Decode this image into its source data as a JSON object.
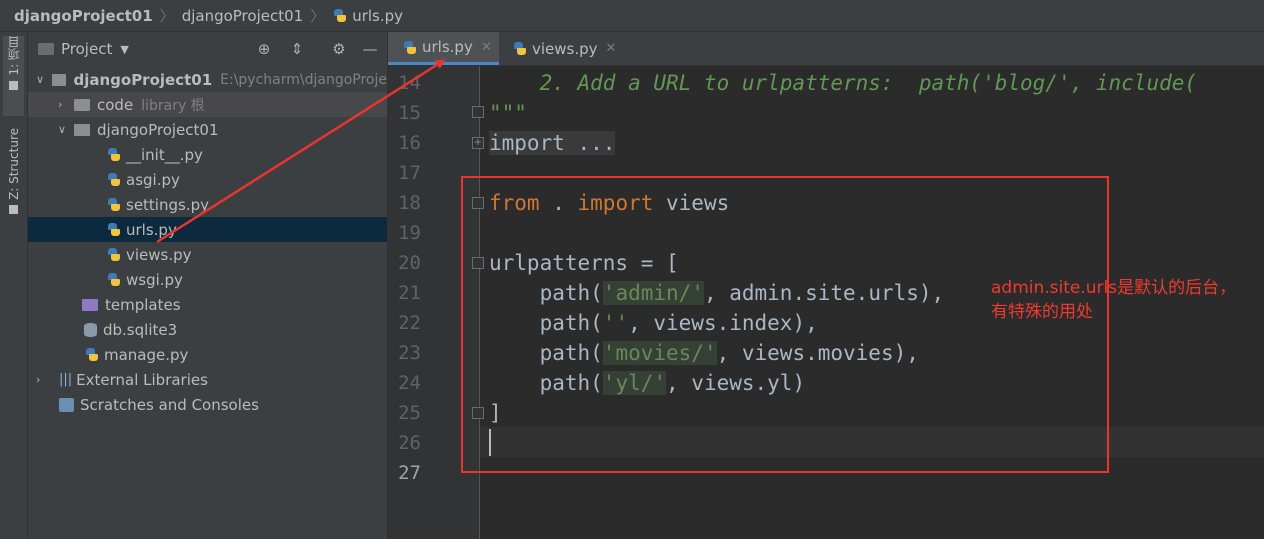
{
  "breadcrumb": [
    "djangoProject01",
    "djangoProject01",
    "urls.py"
  ],
  "left_strip": {
    "project_tab": "1: 项目",
    "structure_tab": "Z: Structure"
  },
  "project_panel": {
    "title": "Project",
    "tree": [
      {
        "label": "djangoProject01",
        "hint": "E:\\pycharm\\djangoProje",
        "expanded": true,
        "icon": "folder-icon"
      },
      {
        "label": "code",
        "hint": "library 根",
        "expanded": false,
        "icon": "folder-icon"
      },
      {
        "label": "djangoProject01",
        "hint": "",
        "expanded": true,
        "icon": "folder-icon"
      },
      {
        "label": "__init__.py",
        "icon": "python-file-icon"
      },
      {
        "label": "asgi.py",
        "icon": "python-file-icon"
      },
      {
        "label": "settings.py",
        "icon": "python-file-icon"
      },
      {
        "label": "urls.py",
        "icon": "python-file-icon",
        "selected": true
      },
      {
        "label": "views.py",
        "icon": "python-file-icon"
      },
      {
        "label": "wsgi.py",
        "icon": "python-file-icon"
      },
      {
        "label": "templates",
        "icon": "folder-icon"
      },
      {
        "label": "db.sqlite3",
        "icon": "database-icon"
      },
      {
        "label": "manage.py",
        "icon": "python-file-icon"
      },
      {
        "label": "External Libraries",
        "icon": "library-icon",
        "expanded": false
      },
      {
        "label": "Scratches and Consoles",
        "icon": "scratches-icon"
      }
    ]
  },
  "editor_tabs": [
    {
      "label": "urls.py",
      "active": true
    },
    {
      "label": "views.py",
      "active": false
    }
  ],
  "editor": {
    "line_numbers": [
      "14",
      "15",
      "16",
      "17",
      "18",
      "19",
      "20",
      "21",
      "22",
      "23",
      "24",
      "25",
      "26",
      "27"
    ],
    "line14": "    2. Add a URL to urlpatterns:  path('blog/', include(",
    "line15": "\"\"\"",
    "line16_kw": "import",
    "line16_rest": " ...",
    "line18_from": "from",
    "line18_mid": " . ",
    "line18_import": "import",
    "line18_rest": " views",
    "line21": "urlpatterns = [",
    "line22_pre": "    path(",
    "line22_str": "'admin/'",
    "line22_post": ", admin.site.urls),",
    "line23_pre": "    path(",
    "line23_str": "''",
    "line23_post": ", views.index),",
    "line24_pre": "    path(",
    "line24_str": "'movies/'",
    "line24_post": ", views.movies),",
    "line25_pre": "    path(",
    "line25_str": "'yl/'",
    "line25_post": ", views.yl)",
    "line26": "]"
  },
  "annotation": {
    "note": "admin.site.urls是默认的后台，有特殊的用处"
  },
  "colors": {
    "accent": "#4a88c7",
    "annotation_red": "#e8352e",
    "keyword": "#cc7832",
    "string": "#6a8759"
  }
}
